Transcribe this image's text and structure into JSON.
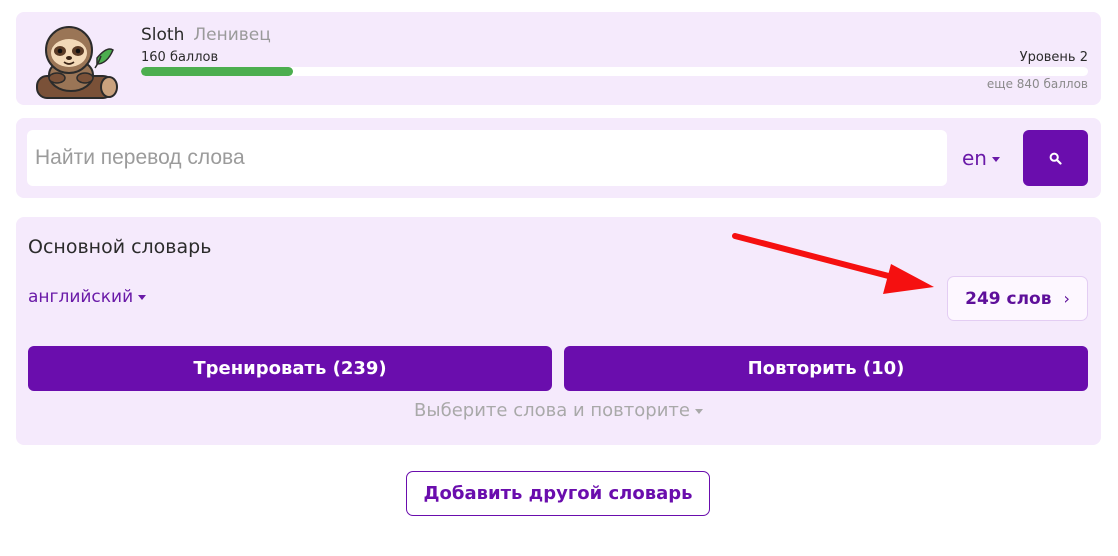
{
  "profile": {
    "name": "Sloth",
    "name_ru": "Ленивец",
    "points": "160 баллов",
    "level": "Уровень 2",
    "remaining": "еще 840 баллов",
    "progress_fraction": 0.16,
    "progress_color": "#4cae4f"
  },
  "search": {
    "placeholder": "Найти перевод слова",
    "lang": "en",
    "button_icon": "search-icon"
  },
  "dictionary": {
    "title": "Основной словарь",
    "language": "английский",
    "words": "249 слов",
    "train": "Тренировать (239)",
    "repeat": "Повторить (10)",
    "select_and_repeat": "Выберите слова и повторите"
  },
  "add_dictionary": "Добавить другой словарь",
  "colors": {
    "accent": "#6a0dad",
    "card_bg": "#f5eafc",
    "annotation_arrow": "#f51010"
  }
}
